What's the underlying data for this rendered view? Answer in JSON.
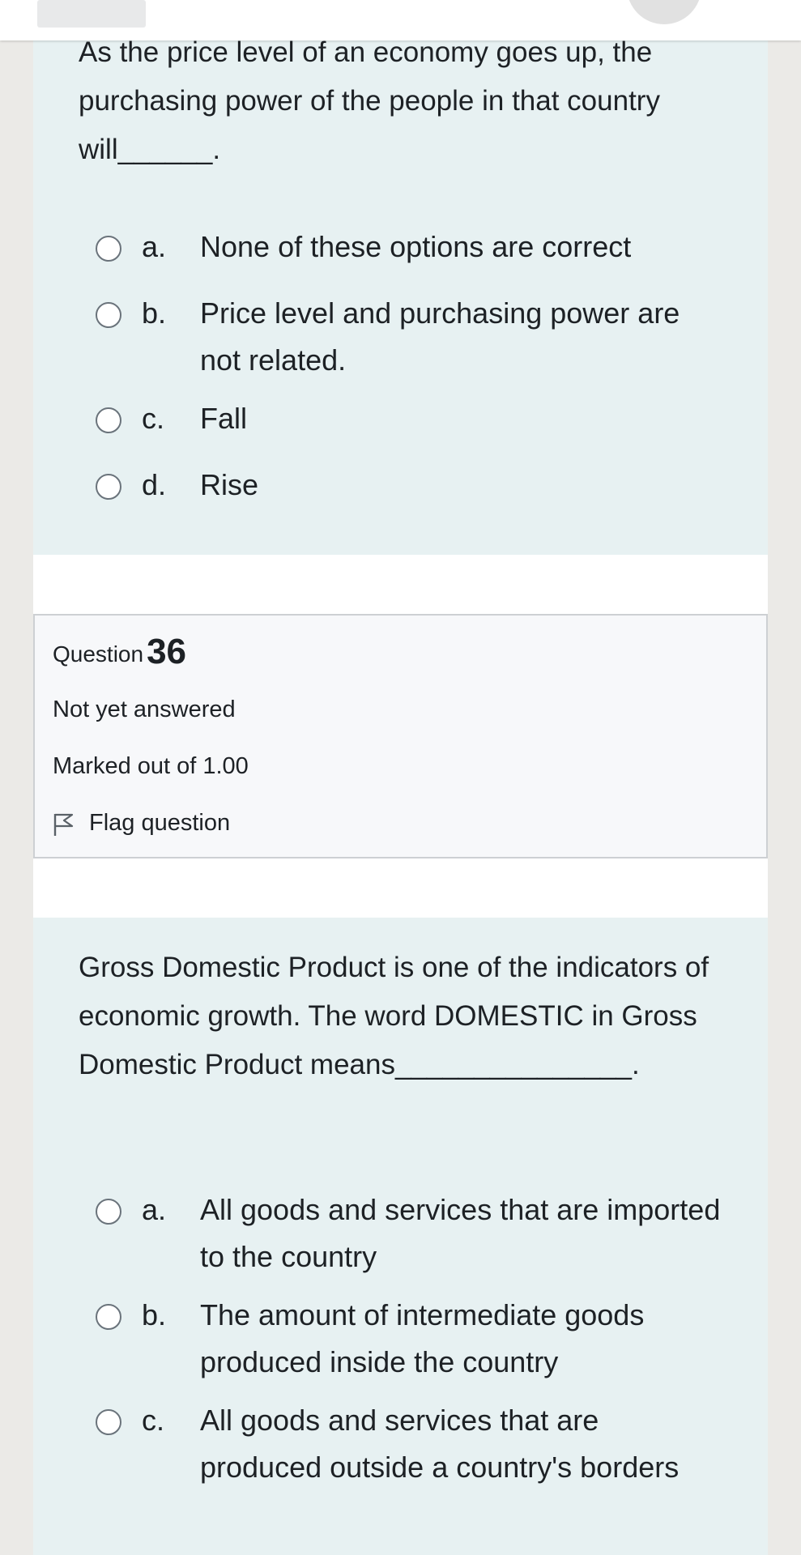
{
  "q1": {
    "text": "As the price level of an economy goes up, the purchasing power of the people in that country will______.",
    "options": [
      {
        "letter": "a.",
        "text": "None of these options are correct"
      },
      {
        "letter": "b.",
        "text": "Price level and purchasing power are not related."
      },
      {
        "letter": "c.",
        "text": "Fall"
      },
      {
        "letter": "d.",
        "text": "Rise"
      }
    ]
  },
  "q2_info": {
    "label": "Question",
    "number": "36",
    "state": "Not yet answered",
    "grade": "Marked out of 1.00",
    "flag_label": "Flag question"
  },
  "q2": {
    "text": "Gross Domestic Product is one of the indicators of economic growth. The word DOMESTIC in Gross Domestic Product means_______________.",
    "options": [
      {
        "letter": "a.",
        "text": "All goods and services that are imported to the country"
      },
      {
        "letter": "b.",
        "text": "The amount of intermediate goods produced inside the country"
      },
      {
        "letter": "c.",
        "text": "All goods and services that are produced outside a country's borders"
      }
    ]
  },
  "colors": {
    "formulation_bg": "#e7f1f2",
    "info_bg": "#f7f8fa",
    "text": "#1d2125"
  }
}
